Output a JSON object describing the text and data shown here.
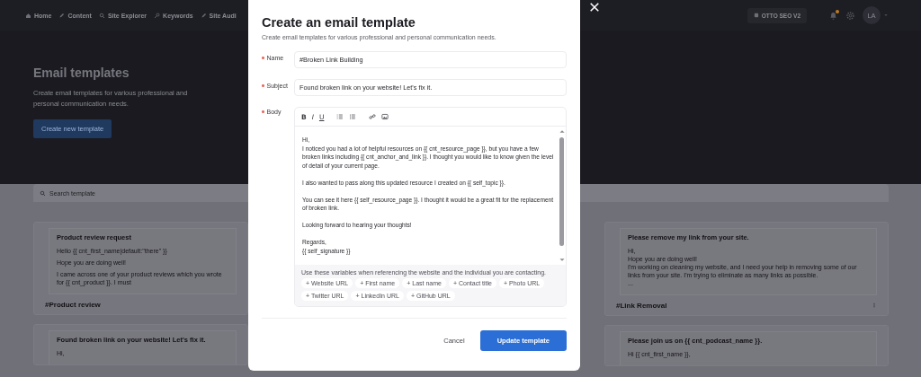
{
  "nav": {
    "items": [
      {
        "label": "Home",
        "kind": "home"
      },
      {
        "label": "Content",
        "kind": "pen"
      },
      {
        "label": "Site Explorer",
        "kind": "search"
      },
      {
        "label": "Keywords",
        "kind": "key"
      },
      {
        "label": "Site Audi",
        "kind": "pen"
      }
    ],
    "project": "OTTO SEO V2",
    "notification": true,
    "avatar": "LA"
  },
  "hero": {
    "title": "Email templates",
    "description": "Create email templates for various professional and personal communication needs.",
    "button": "Create new template"
  },
  "search": {
    "placeholder": "Search template"
  },
  "left_column": [
    {
      "subject": "Product review request",
      "preview": [
        "Hello {{ cnt_first_name|default:\"there\" }}",
        "Hope you are doing well!",
        "I came across one of your product reviews which you wrote for {{ cnt_product }}. I must"
      ],
      "name": "#Product review"
    },
    {
      "subject": "Found broken link on your website! Let's fix it.",
      "preview": [
        "Hi,"
      ]
    }
  ],
  "right_column": [
    {
      "subject": "Please remove my link from your site.",
      "preview": [
        "Hi,\nHope you are doing well!\nI'm working on cleaning my website, and I need your help in removing some of our links from your site. I'm trying to eliminate as many links as possible.\n..."
      ],
      "name": "#Link Removal",
      "menu": true
    },
    {
      "subject": "Please join us on {{ cnt_podcast_name }}.",
      "preview": [
        "Hi {{ cnt_first_name }},"
      ]
    }
  ],
  "modal": {
    "title": "Create an email template",
    "subtitle": "Create email templates for various professional and personal communication needs.",
    "fields": [
      {
        "label": "Name",
        "required": true,
        "value": "#Broken Link Building"
      },
      {
        "label": "Subject",
        "required": true,
        "value": "Found broken link on your website! Let's fix it."
      }
    ],
    "body": {
      "label": "Body",
      "required": true,
      "toolbar": [
        {
          "kind": "bold",
          "label": "B"
        },
        {
          "kind": "italic",
          "label": "I"
        },
        {
          "kind": "underline",
          "label": "U"
        },
        {
          "kind": "ordered-list"
        },
        {
          "kind": "bullet-list"
        },
        {
          "kind": "link"
        },
        {
          "kind": "image"
        }
      ],
      "paragraphs": [
        "Hi,\nI noticed you had a lot of helpful resources on {{ cnt_resource_page }}, but you have a few broken links including {{ cnt_anchor_and_link }}. I thought you would like to know given the level of detail of your current page.",
        "I also wanted to pass along this updated resource I created on {{ self_topic }}.",
        "You can see it here {{ self_resource_page }}. I thought it would be a great fit for the replacement of broken link.",
        "Looking forward to hearing your thoughts!",
        "Regards,\n{{ self_signature }}"
      ],
      "variables_hint": "Use these variables when referencing the website and the individual you are contacting.",
      "variables": [
        "+ Website URL",
        "+ First name",
        "+ Last name",
        "+ Contact title",
        "+ Photo URL",
        "+ Twitter URL",
        "+ LinkedIn URL",
        "+ GitHub URL"
      ]
    },
    "buttons": {
      "cancel": "Cancel",
      "submit": "Update template"
    }
  }
}
